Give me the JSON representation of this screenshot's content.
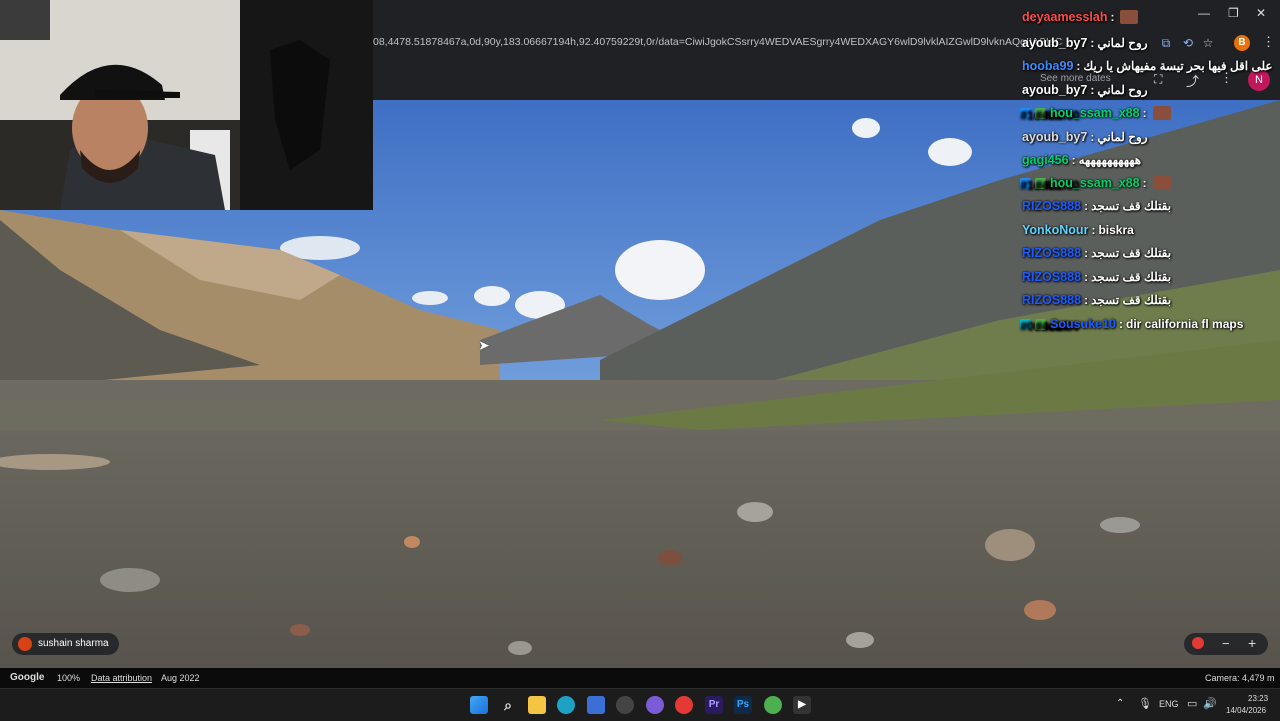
{
  "browser": {
    "url": "08,4478.51878467a,0d,90y,183.06667194h,92.40759229t,0r/data=CiwiJgokCSsrry4WEDVAESgrry4WEDXAGY6wlD9lvklAIZGwlD9lvknAQgIIASIaChZDSUhNMG9n",
    "see_more_dates": "See more dates",
    "profile_initial": "N",
    "ext_initial": "B"
  },
  "window_controls": {
    "minimize": "—",
    "restore": "❐",
    "close": "✕"
  },
  "chat": [
    {
      "user": "deyaamesslah",
      "color": "#ff4b4b",
      "msg": "",
      "emote": true,
      "badges": []
    },
    {
      "user": "ayoub_by7",
      "color": "#ffffff",
      "msg": "روح لماني",
      "emote": false,
      "badges": []
    },
    {
      "user": "hooba99",
      "color": "#3c8cff",
      "msg": "على اقل فيها بحر تيسة مفيهاش يا ريك",
      "emote": false,
      "badges": []
    },
    {
      "user": "ayoub_by7",
      "color": "#ffffff",
      "msg": "روح لماني",
      "emote": false,
      "badges": []
    },
    {
      "user": "hou_ssam_x88",
      "color": "#00d26a",
      "msg": "",
      "emote": true,
      "badges": [
        "#1e90ff",
        "#4caf50"
      ]
    },
    {
      "user": "ayoub_by7",
      "color": "#dcdcdc",
      "msg": "روح لماني",
      "emote": false,
      "badges": []
    },
    {
      "user": "gagi456",
      "color": "#00d26a",
      "msg": "ههههههههههه",
      "emote": false,
      "badges": []
    },
    {
      "user": "hou_ssam_x88",
      "color": "#00d26a",
      "msg": "",
      "emote": true,
      "badges": [
        "#1e90ff",
        "#4caf50"
      ]
    },
    {
      "user": "RIZOS888",
      "color": "#1e5bff",
      "msg": "بقتلك قف تسجد",
      "emote": false,
      "badges": []
    },
    {
      "user": "YonkoNour",
      "color": "#5fd4ff",
      "msg": "biskra",
      "emote": false,
      "badges": []
    },
    {
      "user": "RIZOS888",
      "color": "#1e5bff",
      "msg": "بقتلك قف تسجد",
      "emote": false,
      "badges": []
    },
    {
      "user": "RIZOS888",
      "color": "#1e5bff",
      "msg": "بقتلك قف تسجد",
      "emote": false,
      "badges": []
    },
    {
      "user": "RIZOS888",
      "color": "#1e5bff",
      "msg": "بقتلك قف تسجد",
      "emote": false,
      "badges": []
    },
    {
      "user": "Sousuke10",
      "color": "#1e5bff",
      "msg": "dir california fl maps",
      "emote": false,
      "badges": [
        "#00bcd4",
        "#4caf50"
      ]
    }
  ],
  "maps_footer": {
    "google": "Google",
    "zoom": "100%",
    "attribution": "Data attribution",
    "date": "Aug 2022",
    "camera": "Camera: 4,479 m"
  },
  "contributor": "sushain sharma",
  "taskbar": {
    "lang": "ENG",
    "time": "23:23",
    "date": "14/04/2026"
  }
}
